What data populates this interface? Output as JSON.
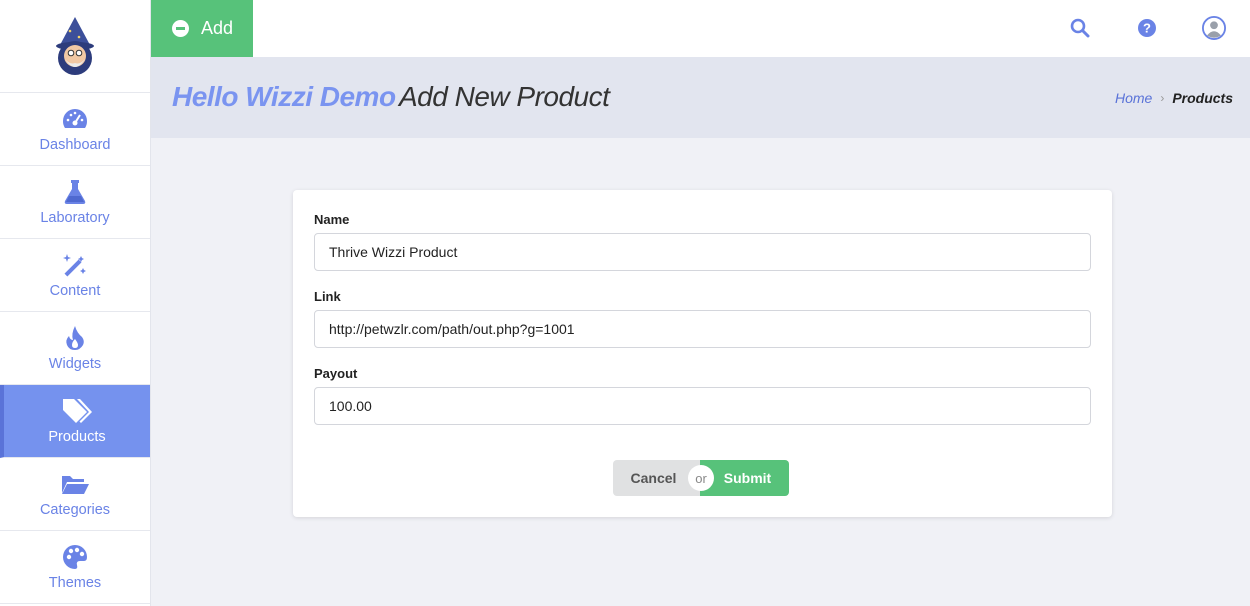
{
  "sidebar": {
    "items": [
      {
        "label": "Dashboard",
        "icon": "dashboard-gauge-icon"
      },
      {
        "label": "Laboratory",
        "icon": "flask-icon"
      },
      {
        "label": "Content",
        "icon": "magic-wand-icon"
      },
      {
        "label": "Widgets",
        "icon": "fire-icon"
      },
      {
        "label": "Products",
        "icon": "tags-icon",
        "active": true
      },
      {
        "label": "Categories",
        "icon": "folder-open-icon"
      },
      {
        "label": "Themes",
        "icon": "palette-icon"
      }
    ]
  },
  "topbar": {
    "add_label": "Add"
  },
  "header": {
    "greeting": "Hello Wizzi Demo",
    "title": "Add New Product"
  },
  "breadcrumb": {
    "home": "Home",
    "current": "Products"
  },
  "form": {
    "name_label": "Name",
    "name_value": "Thrive Wizzi Product",
    "link_label": "Link",
    "link_value": "http://petwzlr.com/path/out.php?g=1001",
    "payout_label": "Payout",
    "payout_value": "100.00",
    "cancel_label": "Cancel",
    "or_label": "or",
    "submit_label": "Submit"
  },
  "colors": {
    "accent": "#7592ee",
    "success": "#57c27a"
  }
}
